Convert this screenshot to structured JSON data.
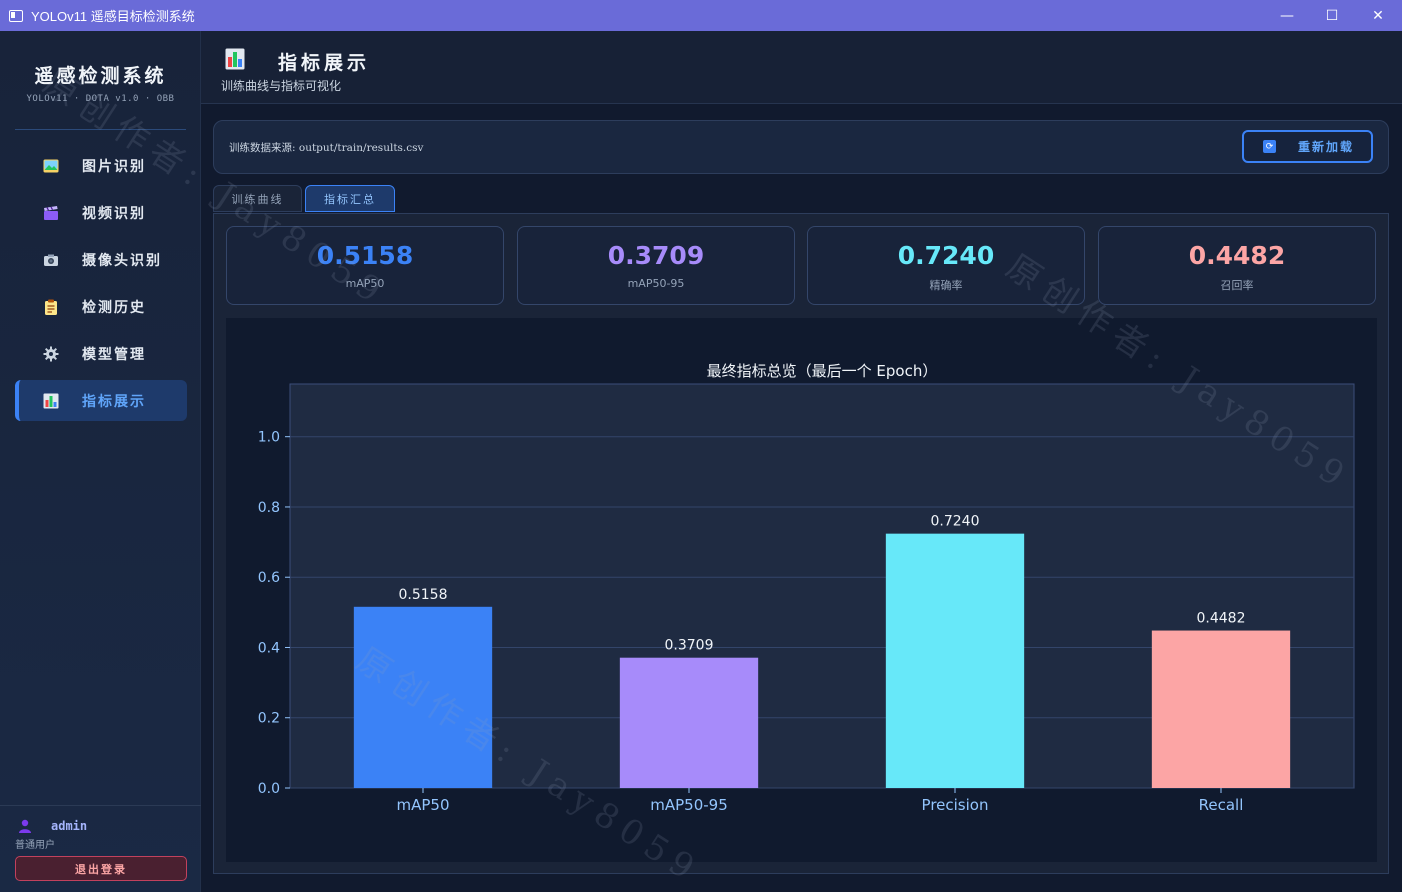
{
  "window": {
    "title": "YOLOv11 遥感目标检测系统",
    "minimize": "—",
    "maximize": "☐",
    "close": "✕"
  },
  "sidebar": {
    "brand_title": "遥感检测系统",
    "brand_subtitle": "YOLOv11 · DOTA v1.0 · OBB",
    "items": [
      {
        "label": "图片识别",
        "icon": "image-icon"
      },
      {
        "label": "视频识别",
        "icon": "clapper-icon"
      },
      {
        "label": "摄像头识别",
        "icon": "camera-icon"
      },
      {
        "label": "检测历史",
        "icon": "clipboard-icon"
      },
      {
        "label": "模型管理",
        "icon": "gear-icon"
      },
      {
        "label": "指标展示",
        "icon": "bar-chart-icon",
        "active": true
      }
    ],
    "user": {
      "name": "admin",
      "role": "普通用户"
    },
    "logout_label": "退出登录"
  },
  "header": {
    "title": "指标展示",
    "subtitle": "训练曲线与指标可视化"
  },
  "source": {
    "text": "训练数据来源: output/train/results.csv",
    "reload_label": "重新加载"
  },
  "tabs": [
    {
      "label": "训练曲线",
      "active": false
    },
    {
      "label": "指标汇总",
      "active": true
    }
  ],
  "cards": [
    {
      "value": "0.5158",
      "label": "mAP50",
      "color": "#3b82f6"
    },
    {
      "value": "0.3709",
      "label": "mAP50-95",
      "color": "#a78bfa"
    },
    {
      "value": "0.7240",
      "label": "精确率",
      "color": "#67e8f9"
    },
    {
      "value": "0.4482",
      "label": "召回率",
      "color": "#fca5a5"
    }
  ],
  "watermark": "原创作者: Jay8059",
  "chart_data": {
    "type": "bar",
    "title": "最终指标总览（最后一个 Epoch）",
    "categories": [
      "mAP50",
      "mAP50-95",
      "Precision",
      "Recall"
    ],
    "values": [
      0.5158,
      0.3709,
      0.724,
      0.4482
    ],
    "value_labels": [
      "0.5158",
      "0.3709",
      "0.7240",
      "0.4482"
    ],
    "colors": [
      "#3b82f6",
      "#a78bfa",
      "#67e8f9",
      "#fca5a5"
    ],
    "ylim": [
      0,
      1.15
    ],
    "yticks": [
      0.0,
      0.2,
      0.4,
      0.6,
      0.8,
      1.0
    ],
    "ytick_labels": [
      "0.0",
      "0.2",
      "0.4",
      "0.6",
      "0.8",
      "1.0"
    ],
    "grid": true,
    "xlabel": "",
    "ylabel": ""
  }
}
